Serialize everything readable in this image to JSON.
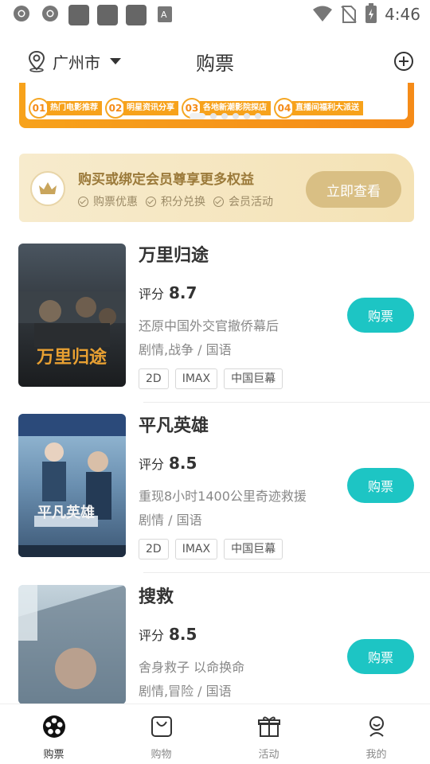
{
  "status_bar": {
    "time": "4:46",
    "icons": [
      "chrome-icon",
      "chrome-icon",
      "app-icon",
      "app-icon",
      "app-icon",
      "translate-icon",
      "wifi-icon",
      "no-sim-icon",
      "battery-charging-icon"
    ]
  },
  "header": {
    "city": "广州市",
    "title": "购票",
    "location_icon": "location-pin-icon",
    "dropdown_icon": "caret-down-icon",
    "add_icon": "plus-circle-icon"
  },
  "banner": {
    "steps": [
      {
        "num": "01",
        "text": "热门电影推荐"
      },
      {
        "num": "02",
        "text": "明星资讯分享"
      },
      {
        "num": "03",
        "text": "各地新潮影院探店"
      },
      {
        "num": "04",
        "text": "直播间福利大派送"
      }
    ],
    "dots": 6,
    "active_dot": 0
  },
  "member": {
    "title": "购买或绑定会员尊享更多权益",
    "perks": [
      "购票优惠",
      "积分兑换",
      "会员活动"
    ],
    "button": "立即查看",
    "icon": "crown-icon"
  },
  "movies": [
    {
      "title": "万里归途",
      "score_label": "评分",
      "score": "8.7",
      "desc": "还原中国外交官撤侨幕后",
      "genre": "剧情,战争 / 国语",
      "tags": [
        "2D",
        "IMAX",
        "中国巨幕"
      ],
      "button": "购票",
      "poster_title": "万里归途"
    },
    {
      "title": "平凡英雄",
      "score_label": "评分",
      "score": "8.5",
      "desc": "重现8小时1400公里奇迹救援",
      "genre": "剧情 / 国语",
      "tags": [
        "2D",
        "IMAX",
        "中国巨幕"
      ],
      "button": "购票",
      "poster_title": "平凡英雄"
    },
    {
      "title": "搜救",
      "score_label": "评分",
      "score": "8.5",
      "desc": "舍身救子 以命换命",
      "genre": "剧情,冒险 / 国语",
      "tags": [],
      "button": "购票",
      "poster_title": ""
    }
  ],
  "bottom_nav": [
    {
      "label": "购票",
      "icon": "film-reel-icon",
      "active": true
    },
    {
      "label": "购物",
      "icon": "shopping-bag-icon",
      "active": false
    },
    {
      "label": "活动",
      "icon": "gift-icon",
      "active": false
    },
    {
      "label": "我的",
      "icon": "user-icon",
      "active": false
    }
  ],
  "colors": {
    "accent": "#1dc5c4",
    "banner_orange": "#f7a21b",
    "member_gold": "#d9bf84"
  }
}
